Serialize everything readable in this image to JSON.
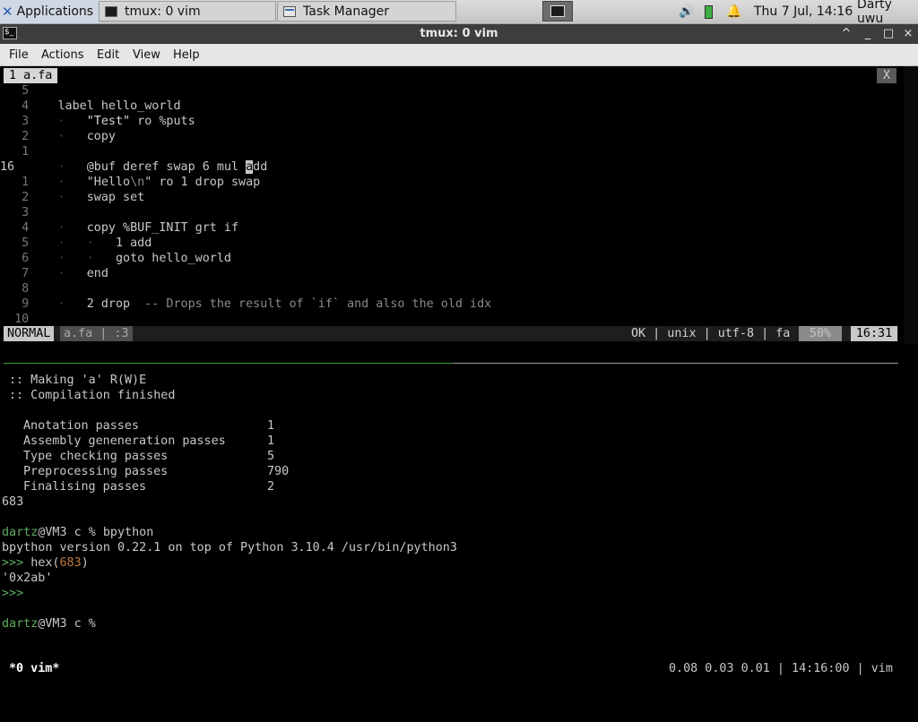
{
  "panel": {
    "applications_label": "Applications",
    "tasks": [
      {
        "label": "tmux: 0 vim"
      },
      {
        "label": "Task Manager"
      }
    ],
    "clock": "Thu  7 Jul, 14:16",
    "user": "Darty uwu"
  },
  "window": {
    "title": "tmux: 0 vim",
    "minimize": "^",
    "maximize": "_",
    "restore": "□",
    "close": "×"
  },
  "menubar": {
    "items": [
      "File",
      "Actions",
      "Edit",
      "View",
      "Help"
    ]
  },
  "vim": {
    "tab_label": "1 a.fa",
    "tab_close": "X",
    "status": {
      "mode": "NORMAL",
      "file": "a.fa | :3",
      "info": "OK | unix | utf-8 | fa",
      "percent": "50%",
      "position": "16:31"
    }
  },
  "output": {
    "making": ":: Making 'a' R(W)E",
    "compiled": ":: Compilation finished",
    "passes": [
      {
        "name": "Anotation passes",
        "value": "1"
      },
      {
        "name": "Assembly geneneration passes",
        "value": "1"
      },
      {
        "name": "Type checking passes",
        "value": "5"
      },
      {
        "name": "Preprocessing passes",
        "value": "790"
      },
      {
        "name": "Finalising passes",
        "value": "2"
      }
    ],
    "result": "683",
    "prompt1_user": "dartz",
    "prompt1_rest": "@VM3 c % bpython",
    "bpython_version": "bpython version 0.22.1 on top of Python 3.10.4 /usr/bin/python3",
    "repl_prompt": ">>>",
    "repl_cmd_fn": " hex(",
    "repl_cmd_arg": "683",
    "repl_cmd_close": ")",
    "repl_result": "'0x2ab'",
    "repl_prompt2": ">>>",
    "prompt2_user": "dartz",
    "prompt2_rest": "@VM3 c %"
  },
  "tmux": {
    "window": "*0 vim*",
    "right": "0.08 0.03 0.01 | 14:16:00 | vim"
  }
}
